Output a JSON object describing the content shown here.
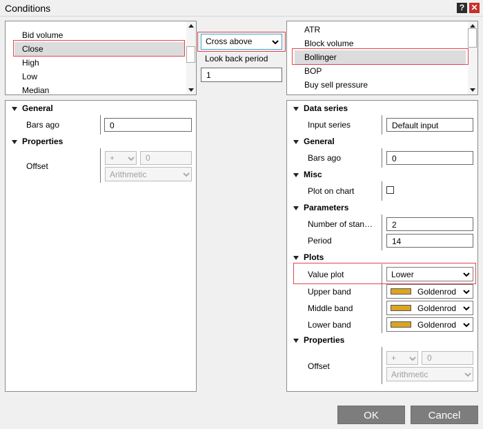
{
  "window": {
    "title": "Conditions",
    "help_glyph": "?",
    "close_glyph": "✕"
  },
  "left_list": {
    "items": [
      "Bid volume",
      "Close",
      "High",
      "Low",
      "Median"
    ],
    "selected": "Close"
  },
  "operator": {
    "value": "Cross above",
    "lookback_label": "Look back period",
    "lookback_value": "1"
  },
  "right_list": {
    "items": [
      "ATR",
      "Block volume",
      "Bollinger",
      "BOP",
      "Buy sell pressure"
    ],
    "selected": "Bollinger"
  },
  "left_props": {
    "general": {
      "title": "General",
      "bars_ago_label": "Bars ago",
      "bars_ago_value": "0"
    },
    "properties": {
      "title": "Properties",
      "offset_label": "Offset",
      "offset_sign": "+",
      "offset_value": "0",
      "offset_mode": "Arithmetic"
    }
  },
  "right_props": {
    "data_series": {
      "title": "Data series",
      "input_label": "Input series",
      "input_value": "Default input"
    },
    "general": {
      "title": "General",
      "bars_ago_label": "Bars ago",
      "bars_ago_value": "0"
    },
    "misc": {
      "title": "Misc",
      "plot_label": "Plot on chart",
      "plot_checked": false
    },
    "parameters": {
      "title": "Parameters",
      "stddev_label": "Number of stan…",
      "stddev_value": "2",
      "period_label": "Period",
      "period_value": "14"
    },
    "plots": {
      "title": "Plots",
      "value_plot_label": "Value plot",
      "value_plot_value": "Lower",
      "upper_label": "Upper band",
      "middle_label": "Middle band",
      "lower_label": "Lower band",
      "band_color_name": "Goldenrod",
      "band_color_hex": "#DAA520"
    },
    "properties": {
      "title": "Properties",
      "offset_label": "Offset",
      "offset_sign": "+",
      "offset_value": "0",
      "offset_mode": "Arithmetic"
    }
  },
  "buttons": {
    "ok": "OK",
    "cancel": "Cancel"
  },
  "colors": {
    "selection_border": "#e0454a",
    "focus_border": "#3fa9d8",
    "button_bg": "#7d7d7d",
    "close_bg": "#c8302a"
  }
}
